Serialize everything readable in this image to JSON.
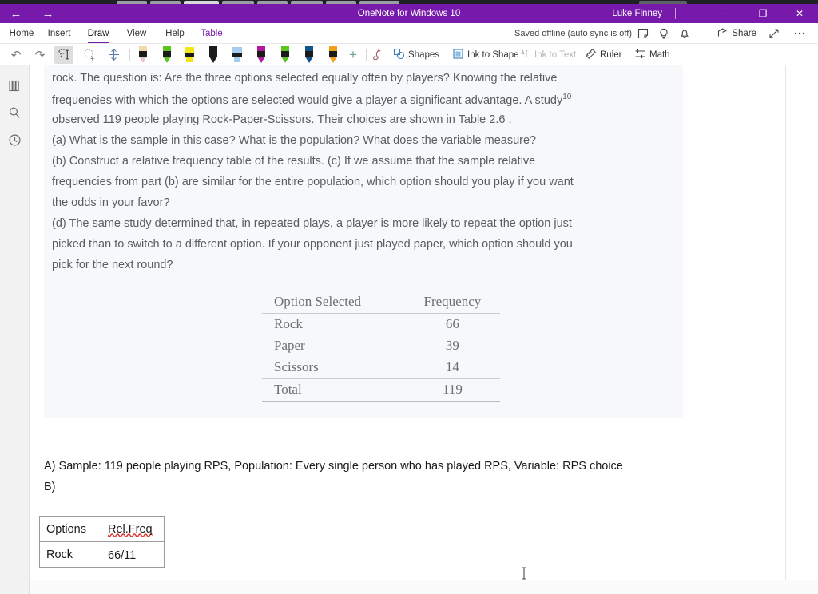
{
  "window": {
    "title": "OneNote for Windows 10",
    "account_name": "Luke Finney",
    "back_arrow": "←",
    "forward_arrow": "→",
    "minimize": "─",
    "maximize": "❐",
    "close": "✕",
    "titlebar_color": "#7719AA"
  },
  "ribbon": {
    "tabs": [
      {
        "label": "Home",
        "active": false,
        "contextual": false
      },
      {
        "label": "Insert",
        "active": false,
        "contextual": false
      },
      {
        "label": "Draw",
        "active": true,
        "contextual": false
      },
      {
        "label": "View",
        "active": false,
        "contextual": false
      },
      {
        "label": "Help",
        "active": false,
        "contextual": false
      },
      {
        "label": "Table",
        "active": false,
        "contextual": true
      }
    ],
    "save_status": "Saved offline (auto sync is off)",
    "share_label": "Share",
    "icons": {
      "sticky_note": "sticky-note-icon",
      "lightbulb": "lightbulb-icon",
      "bell": "bell-icon",
      "share": "share-icon",
      "expand": "expand-arrow-icon",
      "more": "more-options-icon"
    }
  },
  "draw_toolbar": {
    "undo": "↶",
    "redo": "↷",
    "buttons": [
      {
        "name": "lasso-select-tool",
        "selected": true
      },
      {
        "name": "lasso-add-tool",
        "selected": false
      },
      {
        "name": "insert-space-tool",
        "selected": false
      },
      {
        "name": "add-pen-button",
        "selected": false
      }
    ],
    "pens": [
      {
        "name": "eraser-tool",
        "type": "eraser",
        "color": "#e7c4d8",
        "cap": "#f2d9aa"
      },
      {
        "name": "pen-green",
        "type": "pen",
        "color": "#5cc421",
        "cap": "#5cc421"
      },
      {
        "name": "highlighter-yellow",
        "type": "highlighter",
        "color": "#f2e61a",
        "cap": "#f2e61a"
      },
      {
        "name": "pen-black",
        "type": "pen",
        "color": "#1b1b1b",
        "cap": "#1b1b1b"
      },
      {
        "name": "highlighter-lightblue",
        "type": "highlighter",
        "color": "#a4cdf0",
        "cap": "#a4cdf0"
      },
      {
        "name": "pen-magenta",
        "type": "pen",
        "color": "#b01a9c",
        "cap": "#b01a9c"
      },
      {
        "name": "pen-green-2",
        "type": "pen",
        "color": "#5cc421",
        "cap": "#5cc421"
      },
      {
        "name": "pen-darkblue",
        "type": "pen",
        "color": "#10548c",
        "cap": "#10548c"
      },
      {
        "name": "pen-orange",
        "type": "pen",
        "color": "#f0a11e",
        "cap": "#f0a11e"
      }
    ],
    "add_pen": "+",
    "tools": [
      {
        "label": "Shapes",
        "disabled": false,
        "icon": "shapes-icon"
      },
      {
        "label": "Ink to Shape",
        "disabled": false,
        "icon": "ink-to-shape-icon"
      },
      {
        "label": "Ink to Text",
        "disabled": true,
        "icon": "ink-to-text-icon"
      },
      {
        "label": "Ruler",
        "disabled": false,
        "icon": "ruler-icon"
      },
      {
        "label": "Math",
        "disabled": false,
        "icon": "math-icon"
      }
    ]
  },
  "left_rail": {
    "items": [
      {
        "name": "notebooks-icon",
        "label": "Notebooks"
      },
      {
        "name": "search-icon",
        "label": "Search"
      },
      {
        "name": "recent-icon",
        "label": "Recent Notes"
      }
    ]
  },
  "question": {
    "lines": [
      "rock. The question is: Are the three options selected equally often by players? Knowing the relative",
      "frequencies with which the options are selected would give a player a significant advantage. A study",
      "observed 119 people playing Rock-Paper-Scissors. Their choices are shown in Table 2.6 .",
      "(a) What is the sample in this case? What is the population? What does the variable measure?",
      "(b) Construct a relative frequency table of the results. (c) If we assume that the sample relative",
      "frequencies from part (b) are similar for the entire population, which option should you play if you want",
      "the odds in your favor?",
      "(d) The same study determined that, in repeated plays, a player is more likely to repeat the option just",
      "picked than to switch to a different option. If your opponent just played paper, which option should you",
      "pick for the next round?"
    ],
    "footnote_marker": "10"
  },
  "table26": {
    "headers": [
      "Option Selected",
      "Frequency"
    ],
    "rows": [
      {
        "option": "Rock",
        "frequency": "66"
      },
      {
        "option": "Paper",
        "frequency": "39"
      },
      {
        "option": "Scissors",
        "frequency": "14"
      }
    ],
    "total": {
      "option": "Total",
      "frequency": "119"
    }
  },
  "answers": {
    "line_a": "A) Sample: 119 people playing RPS, Population: Every single person who has played RPS, Variable: RPS choice",
    "line_b": "B)"
  },
  "user_table": {
    "header": {
      "col1": "Options",
      "col2": "Rel.Freq"
    },
    "row1": {
      "col1": "Rock",
      "col2": "66/11"
    }
  }
}
